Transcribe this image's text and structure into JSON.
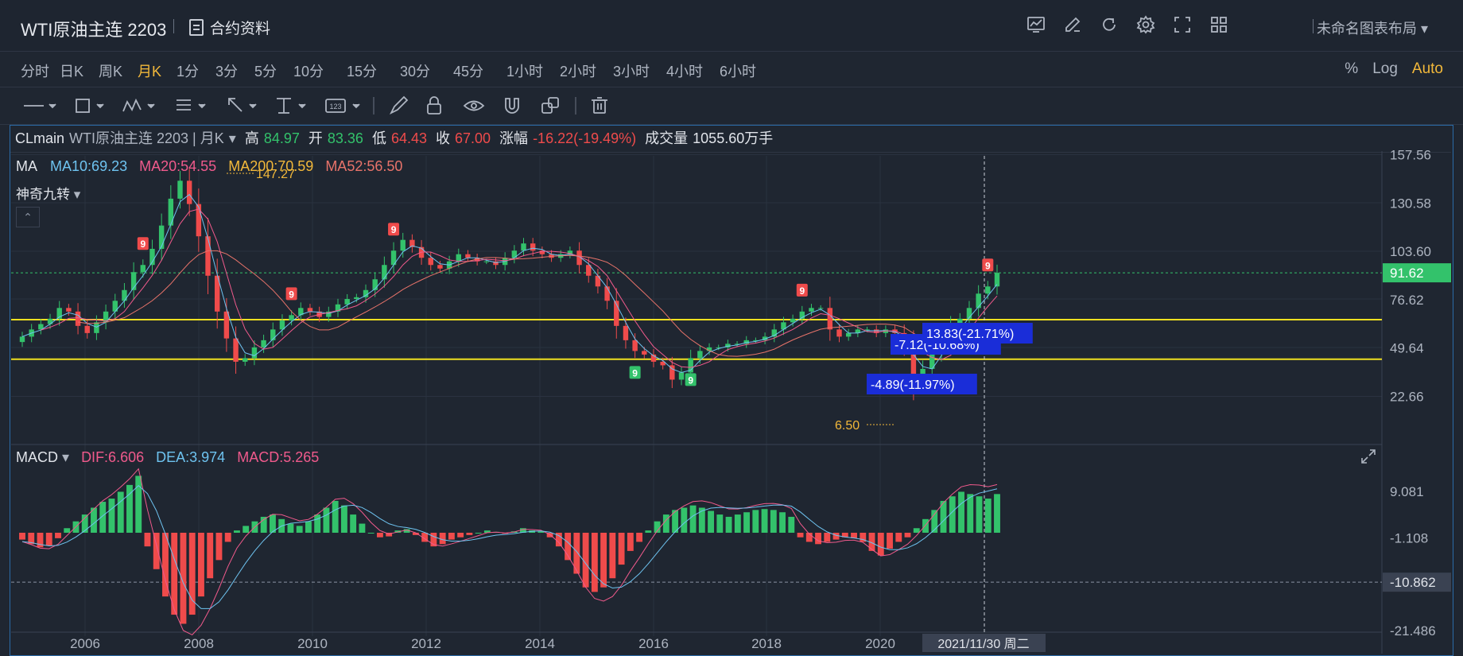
{
  "header": {
    "title": "WTI原油主连 2203",
    "contract_label": "合约资料",
    "layout_label": "未命名图表布局",
    "icons": [
      "chart-icon",
      "edit-icon",
      "refresh-icon",
      "settings-icon",
      "fullscreen-icon",
      "grid-icon"
    ]
  },
  "periods": [
    "分时",
    "日K",
    "周K",
    "月K",
    "1分",
    "3分",
    "5分",
    "10分",
    "15分",
    "30分",
    "45分",
    "1小时",
    "2小时",
    "3小时",
    "4小时",
    "6小时"
  ],
  "active_period": "月K",
  "scale_options": {
    "percent": "%",
    "log": "Log",
    "auto": "Auto"
  },
  "drawing_tools": [
    "line-tool-icon",
    "rect-tool-icon",
    "pattern-tool-icon",
    "fib-tool-icon",
    "arrow-tool-icon",
    "measure-tool-icon",
    "text-tool-icon",
    "brush-icon",
    "lock-icon",
    "eye-icon",
    "magnet-icon",
    "clone-icon",
    "trash-icon"
  ],
  "info": {
    "symbol": "CLmain",
    "name": "WTI原油主连 2203 | 月K",
    "high_label": "高",
    "high": "84.97",
    "open_label": "开",
    "open": "83.36",
    "low_label": "低",
    "low": "64.43",
    "close_label": "收",
    "close": "67.00",
    "change_label": "涨幅",
    "change": "-16.22(-19.49%)",
    "volume_label": "成交量",
    "volume": "1055.60万手"
  },
  "ma": {
    "label": "MA",
    "ma10": "MA10:69.23",
    "ma20": "MA20:54.55",
    "ma200": "MA200:70.59",
    "ma52": "MA52:56.50",
    "indicator2": "神奇九转"
  },
  "macd": {
    "label": "MACD",
    "dif": "DIF:6.606",
    "dea": "DEA:3.974",
    "macd": "MACD:5.265"
  },
  "colors": {
    "up": "#33c26b",
    "down": "#ef4b4b",
    "ma10": "#6ec3f0",
    "ma20": "#f05a8c",
    "ma200": "#f2b83a",
    "ma52": "#e8736a",
    "support": "#f0e020",
    "label_bg": "#1a2dd8"
  },
  "chart_data": {
    "type": "candlestick",
    "title": "WTI原油主连 2203",
    "x_ticks": [
      "2006",
      "2008",
      "2010",
      "2012",
      "2014",
      "2016",
      "2018",
      "2020"
    ],
    "price_ticks": [
      "157.56",
      "130.58",
      "103.60",
      "76.62",
      "49.64",
      "22.66"
    ],
    "macd_ticks": [
      "9.081",
      "-1.108",
      "-21.486"
    ],
    "current_price": "91.62",
    "crosshair_value": "-10.862",
    "crosshair_date": "2021/11/30 周二",
    "annotations": [
      "147.27",
      "6.50",
      "-4.89(-11.97%)",
      "-7.12(-10.68%)",
      "13.83(-21.71%)"
    ],
    "horizontal_levels": [
      65.5,
      43.4
    ],
    "closes": [
      56,
      60,
      63,
      66,
      72,
      70,
      62,
      58,
      64,
      70,
      76,
      82,
      92,
      96,
      105,
      118,
      133,
      143,
      130,
      112,
      90,
      70,
      55,
      42,
      44,
      50,
      54,
      60,
      65,
      68,
      72,
      70,
      67,
      70,
      74,
      77,
      78,
      82,
      88,
      96,
      104,
      110,
      106,
      100,
      96,
      94,
      98,
      102,
      100,
      98,
      98,
      96,
      100,
      104,
      108,
      104,
      102,
      100,
      102,
      104,
      96,
      90,
      84,
      76,
      62,
      54,
      48,
      46,
      42,
      40,
      32,
      36,
      44,
      48,
      50,
      50,
      52,
      52,
      54,
      54,
      56,
      60,
      64,
      66,
      70,
      72,
      72,
      60,
      56,
      58,
      60,
      60,
      58,
      60,
      58,
      50,
      30,
      38,
      46,
      52,
      62,
      66,
      72,
      80,
      84,
      91.6
    ],
    "macd_hist": [
      -1.5,
      -2.5,
      -3.2,
      -2.8,
      -1.2,
      1,
      2.5,
      4,
      5.5,
      6.8,
      7.5,
      9,
      10.5,
      12.5,
      -3,
      -8,
      -14,
      -18,
      -20,
      -18,
      -14,
      -10,
      -6,
      -2,
      0.5,
      1.5,
      2.5,
      3.5,
      4,
      3,
      2,
      1.5,
      2.5,
      4,
      5.5,
      7,
      6,
      4,
      2,
      0,
      -1,
      -0.8,
      0.5,
      0.8,
      -0.5,
      -2,
      -3,
      -2.5,
      -1.5,
      -1,
      -0.5,
      0,
      0.5,
      0.2,
      -0.2,
      0.3,
      1,
      0.5,
      0.3,
      -1,
      -3,
      -6,
      -9,
      -12,
      -13,
      -12,
      -10,
      -7,
      -4,
      -2,
      0.5,
      2.5,
      4,
      5,
      5.5,
      6,
      5.5,
      4.8,
      4,
      3.5,
      4,
      4.5,
      5,
      5.2,
      5,
      4.5,
      3.5,
      -1,
      -2,
      -2.5,
      -2,
      -1.5,
      -1,
      -1.2,
      -2,
      -4,
      -5,
      -3.5,
      -2,
      -1,
      1,
      3,
      5,
      7,
      8,
      9,
      8.5,
      8,
      7.5,
      8.5
    ]
  }
}
